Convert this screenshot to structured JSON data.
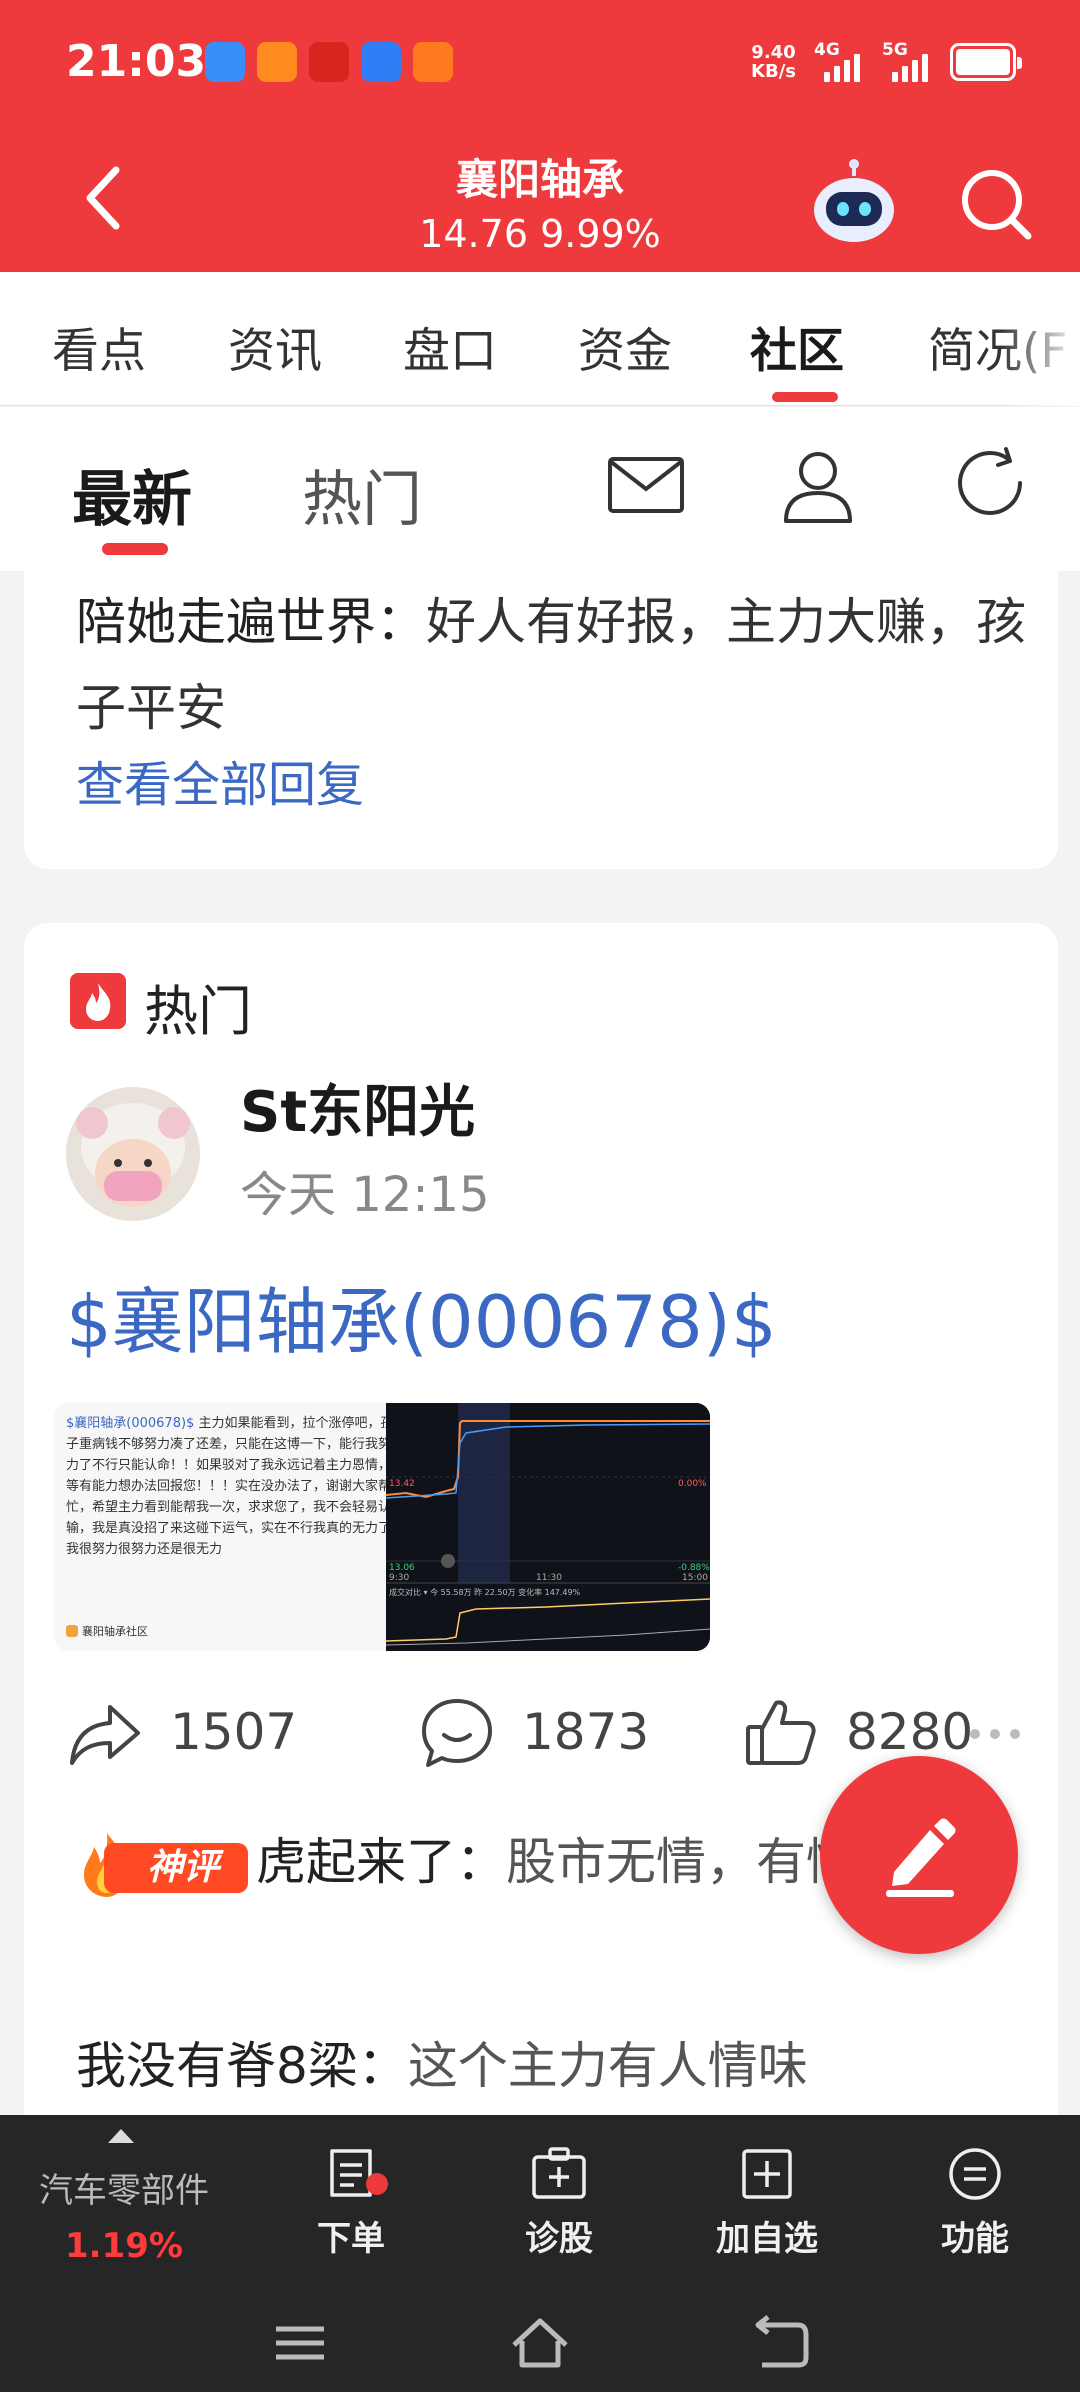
{
  "status_bar": {
    "time": "21:03",
    "net_speed_value": "9.40",
    "net_speed_unit": "KB/s",
    "sim1": "4G",
    "sim2": "5G"
  },
  "header": {
    "stock_name": "襄阳轴承",
    "stock_quote": "14.76 9.99%"
  },
  "tabs": [
    "看点",
    "资讯",
    "盘口",
    "资金",
    "社区",
    "简况(F"
  ],
  "active_tab_index": 4,
  "subtabs": {
    "latest": "最新",
    "hot": "热门"
  },
  "prev_card": {
    "reply_user": "陪她走遍世界：",
    "reply_text": "好人有好报，主力大赚，孩子平安",
    "see_all": "查看全部回复"
  },
  "post": {
    "badge_label": "热门",
    "author": "St东阳光",
    "time": "今天 12:15",
    "stock_tag": "$襄阳轴承(000678)$",
    "image_text_tag": "$襄阳轴承(000678)$",
    "image_text": " 主力如果能看到，拉个涨停吧，孩子重病钱不够努力凑了还差，只能在这博一下，能行我努力了不行只能认命！！如果驳对了我永远记着主力恩情，等有能力想办法回报您！！！实在没办法了，谢谢大家帮忙，希望主力看到能帮我一次，求求您了，我不会轻易认输，我是真没招了来这碰下运气，实在不行我真的无力了我很努力很努力还是很无力",
    "image_footer": "襄阳轴承社区",
    "chart_labels": {
      "price_left": "13.42",
      "pct_right": "0.00%",
      "low_left": "13.06",
      "low_right": "-0.88%",
      "t_start": "9:30",
      "t_mid": "11:30",
      "t_end": "15:00",
      "volume_info": "成交对比 ▾ 今 55.58万  昨 22.50万  变化率 147.49%"
    },
    "shares": "1507",
    "comments": "1873",
    "likes": "8280"
  },
  "comments": [
    {
      "badge": "神评",
      "user": "虎起来了：",
      "text": "股市无情，有情"
    },
    {
      "user": "我没有脊8梁：",
      "text": "这个主力有人情味"
    }
  ],
  "dock": {
    "sector_name": "汽车零部件",
    "sector_change": "1.19%",
    "order": "下单",
    "diagnose": "诊股",
    "add_watch": "加自选",
    "functions": "功能"
  },
  "colors": {
    "brand_red": "#ee3a3c",
    "link_blue": "#3b68c2",
    "dock_bg": "#262626"
  }
}
